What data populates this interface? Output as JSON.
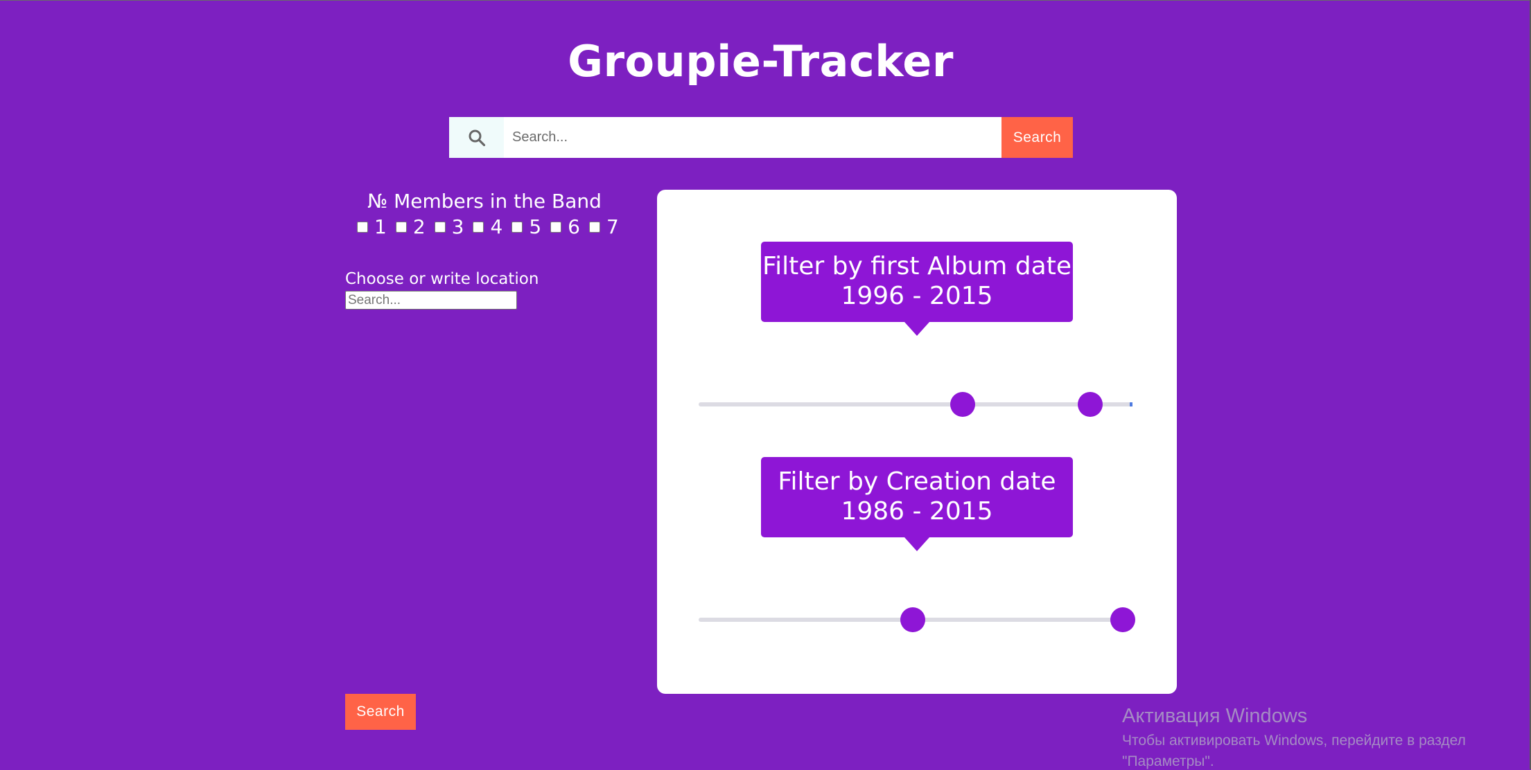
{
  "header": {
    "title": "Groupie-Tracker"
  },
  "search": {
    "icon": "search-icon",
    "placeholder": "Search...",
    "value": "",
    "button_label": "Search"
  },
  "filters": {
    "members": {
      "title": "№ Members in the Band",
      "options": [
        "1",
        "2",
        "3",
        "4",
        "5",
        "6",
        "7"
      ],
      "checked": []
    },
    "location": {
      "label": "Choose or write location",
      "placeholder": "Search...",
      "value": ""
    },
    "submit_label": "Search"
  },
  "range_filters": [
    {
      "label": "Filter by first Album date",
      "range_text": "1996 - 2015",
      "handles_fraction": [
        0.61,
        0.905
      ]
    },
    {
      "label": "Filter by Creation date",
      "range_text": "1986 - 2015",
      "handles_fraction": [
        0.495,
        0.98
      ]
    }
  ],
  "colors": {
    "background": "#7d20c1",
    "accent": "#8e16d6",
    "button": "#ff6347",
    "card": "#ffffff"
  },
  "watermark": {
    "title": "Активация Windows",
    "line1": "Чтобы активировать Windows, перейдите в раздел",
    "line2": "\"Параметры\"."
  }
}
